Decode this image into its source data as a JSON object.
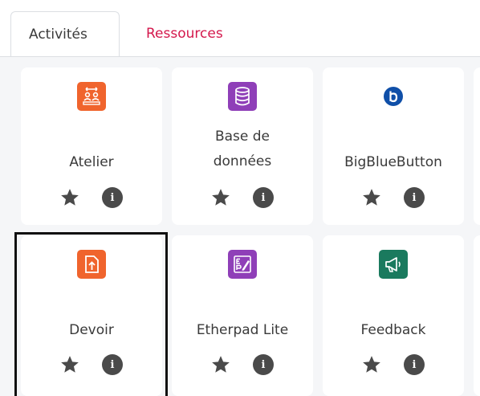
{
  "tabs": [
    {
      "label": "Activités",
      "active": true
    },
    {
      "label": "Ressources",
      "active": false
    }
  ],
  "colors": {
    "accent": "#d4184c",
    "atelier": "#f0642d",
    "base_de_donnees": "#8f3fb8",
    "bigbluebutton": "#0f4fa8",
    "devoir": "#f0642d",
    "etherpad": "#8f3fb8",
    "feedback": "#1a7a5e"
  },
  "activities": [
    {
      "name": "Atelier",
      "icon": "workshop-icon"
    },
    {
      "name_line1": "Base de",
      "name_line2": "données",
      "icon": "database-icon"
    },
    {
      "name": "BigBlueButton",
      "icon": "bigbluebutton-icon"
    },
    {
      "name": "Devoir",
      "icon": "assignment-upload-icon"
    },
    {
      "name": "Etherpad Lite",
      "icon": "etherpad-icon"
    },
    {
      "name": "Feedback",
      "icon": "megaphone-icon"
    }
  ],
  "info_glyph": "i"
}
